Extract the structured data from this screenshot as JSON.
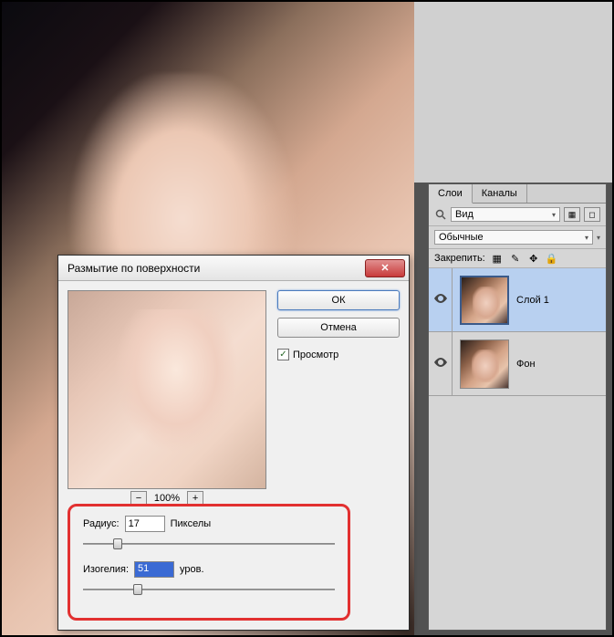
{
  "canvas": {},
  "layers_panel": {
    "tabs": {
      "layers": "Слои",
      "channels": "Каналы"
    },
    "filter_label": "Вид",
    "blend_mode": "Обычные",
    "lock_label": "Закрепить:",
    "layers": [
      {
        "name": "Слой 1",
        "visible": true,
        "selected": true
      },
      {
        "name": "Фон",
        "visible": true,
        "selected": false
      }
    ]
  },
  "dialog": {
    "title": "Размытие по поверхности",
    "ok": "ОК",
    "cancel": "Отмена",
    "preview_chk": "Просмотр",
    "preview_checked": true,
    "zoom": "100%",
    "radius": {
      "label": "Радиус:",
      "value": "17",
      "unit": "Пикселы",
      "pos_pct": 12
    },
    "threshold": {
      "label": "Изогелия:",
      "value": "51",
      "unit": "уров.",
      "pos_pct": 20
    }
  }
}
